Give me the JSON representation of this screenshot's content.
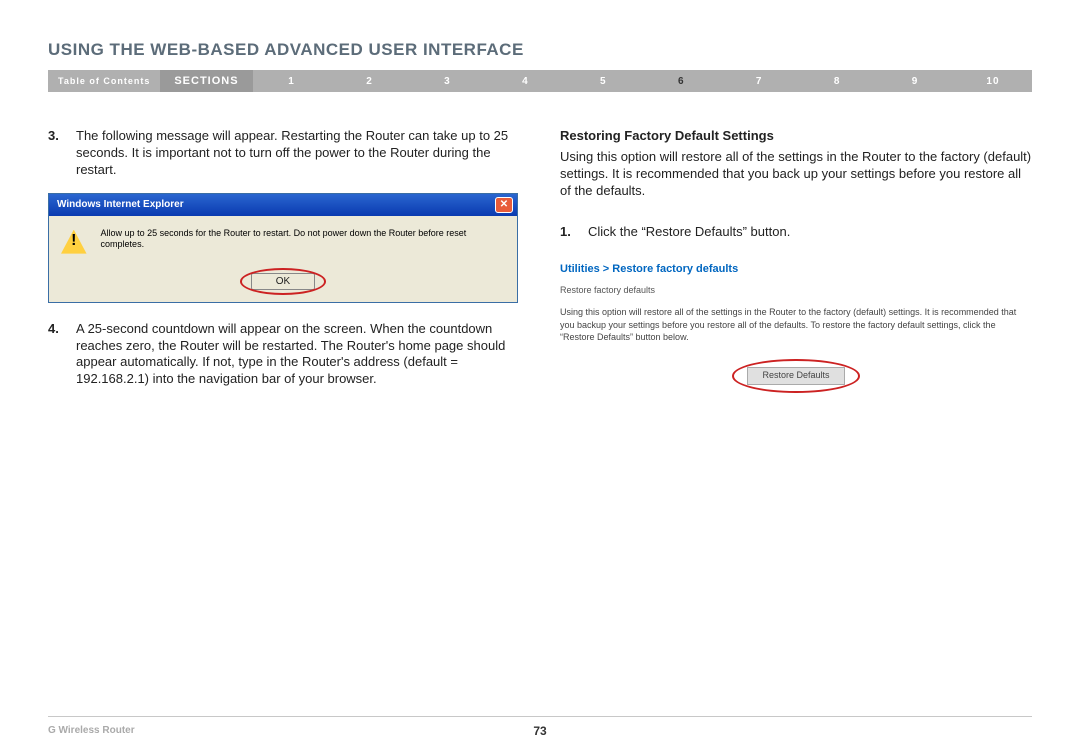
{
  "title": "USING THE WEB-BASED ADVANCED USER INTERFACE",
  "nav": {
    "toc": "Table of Contents",
    "sections_label": "SECTIONS",
    "numbers": [
      "1",
      "2",
      "3",
      "4",
      "5",
      "6",
      "7",
      "8",
      "9",
      "10"
    ],
    "active": "6"
  },
  "left": {
    "step3": {
      "num": "3.",
      "text": "The following message will appear. Restarting the Router can take up to 25 seconds. It is important not to turn off the power to the Router during the restart."
    },
    "dialog": {
      "title": "Windows Internet Explorer",
      "message": "Allow up to 25 seconds for the Router to restart. Do not power down the Router before reset completes.",
      "ok": "OK"
    },
    "step4": {
      "num": "4.",
      "text": "A 25-second countdown will appear on the screen. When the countdown reaches zero, the Router will be restarted. The Router's home page should appear automatically. If not, type in the Router's address (default = 192.168.2.1) into the navigation bar of your browser."
    }
  },
  "right": {
    "heading": "Restoring Factory Default Settings",
    "intro": "Using this option will restore all of the settings in the Router to the factory (default) settings. It is recommended that you back up your settings before you restore all of the defaults.",
    "step1": {
      "num": "1.",
      "text": "Click the “Restore Defaults” button."
    },
    "breadcrumb": "Utilities > Restore factory defaults",
    "panel": {
      "subtitle": "Restore factory defaults",
      "help": "Using this option will restore all of the settings in the Router to the factory (default) settings. It is recommended that you backup your settings before you restore all of the defaults. To restore the factory default settings, click the “Restore Defaults” button below.",
      "button": "Restore Defaults"
    }
  },
  "footer": {
    "product": "G Wireless Router",
    "page": "73"
  }
}
